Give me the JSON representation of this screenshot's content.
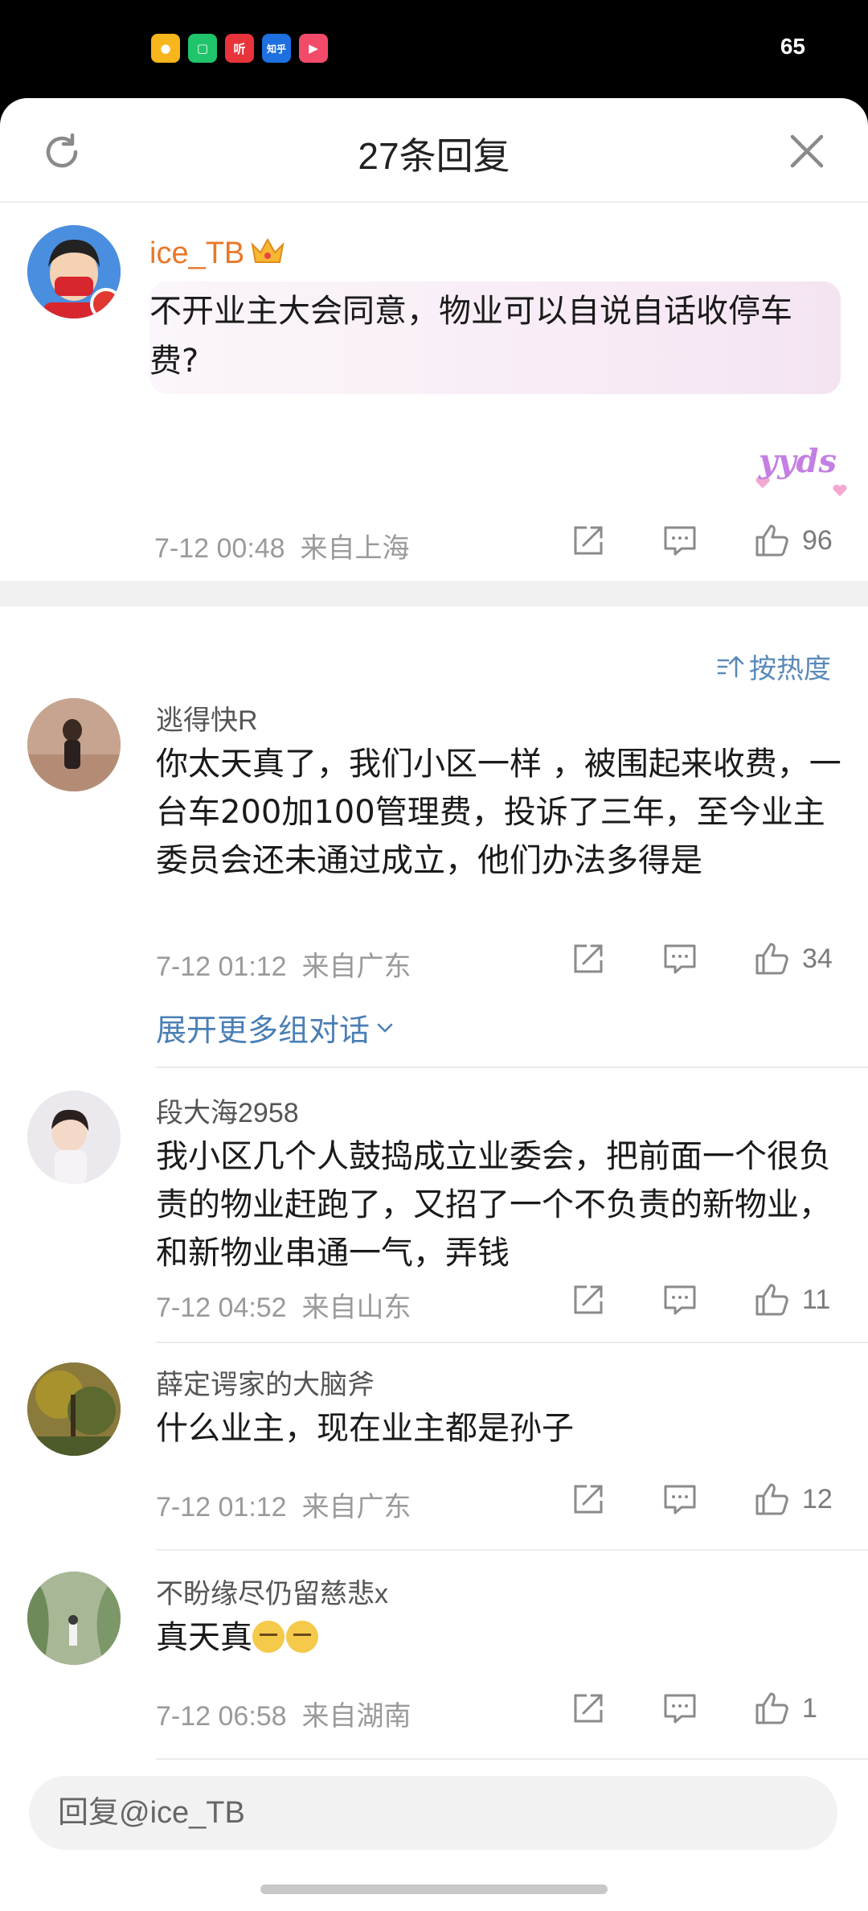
{
  "status": {
    "battery": "65"
  },
  "header": {
    "title": "27条回复",
    "refresh_icon": "refresh-icon",
    "close_icon": "close-icon"
  },
  "main_comment": {
    "username": "ice_TB",
    "text": "不开业主大会同意，物业可以自说自话收停车费?",
    "sticker": "yyds",
    "time": "7-12 00:48",
    "location": "来自上海",
    "likes": "96"
  },
  "sort": {
    "label": "按热度"
  },
  "comments": [
    {
      "username": "逃得快R",
      "text": "你太天真了，我们小区一样 ，被围起来收费，一台车200加100管理费，投诉了三年，至今业主委员会还未通过成立，他们办法多得是",
      "time": "7-12 01:12",
      "location": "来自广东",
      "likes": "34",
      "expand": "展开更多组对话"
    },
    {
      "username": "段大海2958",
      "text": "我小区几个人鼓捣成立业委会，把前面一个很负责的物业赶跑了，又招了一个不负责的新物业，和新物业串通一气，弄钱",
      "time": "7-12 04:52",
      "location": "来自山东",
      "likes": "11"
    },
    {
      "username": "薛定谔家的大脑斧",
      "text": "什么业主，现在业主都是孙子",
      "time": "7-12 01:12",
      "location": "来自广东",
      "likes": "12"
    },
    {
      "username": "不盼缘尽仍留慈悲x",
      "text": "真天真",
      "time": "7-12 06:58",
      "location": "来自湖南",
      "likes": "1"
    }
  ],
  "reply": {
    "placeholder": "回复@ice_TB"
  }
}
